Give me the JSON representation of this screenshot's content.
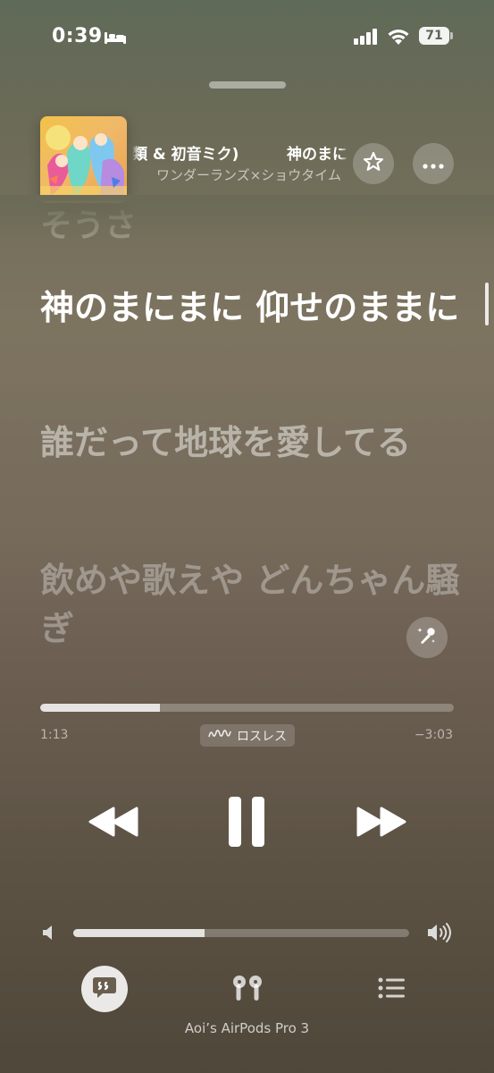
{
  "status_bar": {
    "time": "0:39",
    "battery": "71",
    "icons": [
      "bed-icon",
      "signal-icon",
      "wifi-icon",
      "battery-icon"
    ]
  },
  "now_playing": {
    "title_fragment_1": "類 & 初音ミク)",
    "title_fragment_2": "神のまに",
    "artist": "ワンダーランズ×ショウタイム",
    "icons": [
      "album-art",
      "star-icon",
      "more-icon"
    ]
  },
  "lyrics": {
    "previous": "そうさ",
    "current": "神のまにまに 仰せのままに",
    "next_1": "誰だって地球を愛してる",
    "next_2": "飲めや歌えや どんちゃん騒ぎ"
  },
  "playback": {
    "elapsed": "1:13",
    "remaining": "−3:03",
    "progress_fraction": 0.29,
    "quality_badge": "ロスレス"
  },
  "volume": {
    "level_fraction": 0.39
  },
  "output": {
    "device": "Aoi’s AirPods Pro 3"
  },
  "colors": {
    "background_top": "#606a58",
    "background_bottom": "#4f4739",
    "text_primary": "#ffffff"
  }
}
